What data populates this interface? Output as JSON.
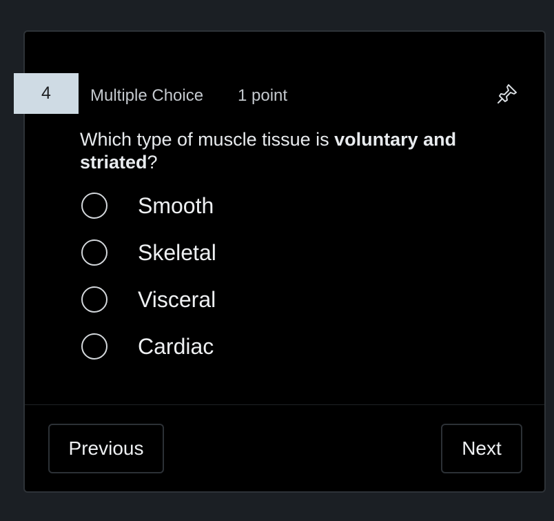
{
  "question": {
    "number": "4",
    "type": "Multiple Choice",
    "points": "1 point",
    "text_prefix": "Which type of muscle tissue is ",
    "text_bold_1": "voluntary and",
    "text_bold_2": "striated",
    "text_suffix": "?",
    "pin_icon": "pin-icon"
  },
  "options": [
    {
      "label": "Smooth",
      "selected": false
    },
    {
      "label": "Skeletal",
      "selected": false
    },
    {
      "label": "Visceral",
      "selected": false
    },
    {
      "label": "Cardiac",
      "selected": false
    }
  ],
  "navigation": {
    "previous_label": "Previous",
    "next_label": "Next"
  },
  "colors": {
    "background": "#1b1f24",
    "card": "#000000",
    "number_badge": "#cfdbe4",
    "text": "#eef0f2",
    "muted_text": "#c4c9ce"
  }
}
